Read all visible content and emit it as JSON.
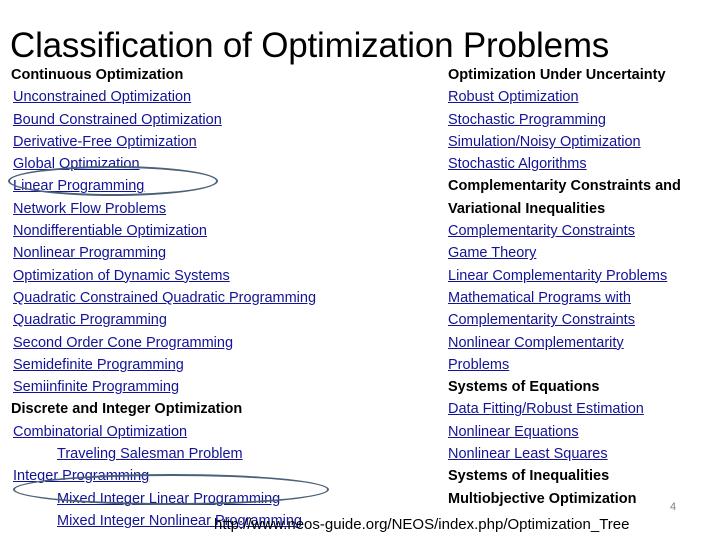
{
  "slide": {
    "title": "Classification of Optimization Problems",
    "page_number": "4",
    "footer_url": "http://www.neos-guide.org/NEOS/index.php/Optimization_Tree",
    "colors": {
      "link": "#131396",
      "text": "#000000",
      "annotation": "#4a6278",
      "page_number": "#7f7f7f",
      "background": "#ffffff"
    }
  },
  "left_column": {
    "items": [
      {
        "label": "Continuous Optimization",
        "kind": "header",
        "indent": 0
      },
      {
        "label": "Unconstrained Optimization",
        "kind": "link",
        "indent": 0
      },
      {
        "label": "Bound Constrained Optimization",
        "kind": "link",
        "indent": 0
      },
      {
        "label": "Derivative-Free Optimization",
        "kind": "link",
        "indent": 0
      },
      {
        "label": "Global Optimization",
        "kind": "link",
        "indent": 0
      },
      {
        "label": "Linear Programming",
        "kind": "link",
        "indent": 0
      },
      {
        "label": "Network Flow Problems",
        "kind": "link",
        "indent": 0
      },
      {
        "label": "Nondifferentiable Optimization",
        "kind": "link",
        "indent": 0
      },
      {
        "label": "Nonlinear Programming",
        "kind": "link",
        "indent": 0
      },
      {
        "label": "Optimization of Dynamic Systems",
        "kind": "link",
        "indent": 0
      },
      {
        "label": "Quadratic Constrained Quadratic Programming",
        "kind": "link",
        "indent": 0
      },
      {
        "label": "Quadratic Programming",
        "kind": "link",
        "indent": 0
      },
      {
        "label": "Second Order Cone Programming",
        "kind": "link",
        "indent": 0
      },
      {
        "label": "Semidefinite Programming",
        "kind": "link",
        "indent": 0
      },
      {
        "label": "Semiinfinite Programming",
        "kind": "link",
        "indent": 0
      },
      {
        "label": "Discrete and Integer Optimization",
        "kind": "header",
        "indent": 0
      },
      {
        "label": "Combinatorial Optimization",
        "kind": "link",
        "indent": 0
      },
      {
        "label": "Traveling Salesman Problem",
        "kind": "link",
        "indent": 1
      },
      {
        "label": "Integer Programming",
        "kind": "link",
        "indent": 0
      },
      {
        "label": "Mixed Integer Linear Programming",
        "kind": "link",
        "indent": 1
      },
      {
        "label": "Mixed Integer Nonlinear Programming",
        "kind": "link",
        "indent": 1
      }
    ]
  },
  "right_column": {
    "items": [
      {
        "label": "Optimization Under Uncertainty",
        "kind": "header",
        "indent": 0
      },
      {
        "label": "Robust Optimization",
        "kind": "link",
        "indent": 0
      },
      {
        "label": "Stochastic Programming",
        "kind": "link",
        "indent": 0
      },
      {
        "label": "Simulation/Noisy Optimization",
        "kind": "link",
        "indent": 0
      },
      {
        "label": "Stochastic Algorithms",
        "kind": "link",
        "indent": 0
      },
      {
        "label": "Complementarity Constraints and",
        "kind": "header",
        "indent": 0
      },
      {
        "label": "Variational Inequalities",
        "kind": "header",
        "indent": 0
      },
      {
        "label": "Complementarity Constraints",
        "kind": "link",
        "indent": 0
      },
      {
        "label": "Game Theory",
        "kind": "link",
        "indent": 0
      },
      {
        "label": "Linear Complementarity Problems",
        "kind": "link",
        "indent": 0
      },
      {
        "label": "Mathematical Programs with",
        "kind": "link",
        "indent": 0
      },
      {
        "label": "Complementarity Constraints",
        "kind": "link",
        "indent": 0
      },
      {
        "label": "Nonlinear Complementarity",
        "kind": "link",
        "indent": 0
      },
      {
        "label": "Problems",
        "kind": "link",
        "indent": 0
      },
      {
        "label": "Systems of Equations",
        "kind": "header",
        "indent": 0
      },
      {
        "label": "Data Fitting/Robust Estimation",
        "kind": "link",
        "indent": 0
      },
      {
        "label": "Nonlinear Equations",
        "kind": "link",
        "indent": 0
      },
      {
        "label": "Nonlinear Least Squares",
        "kind": "link",
        "indent": 0
      },
      {
        "label": "Systems of Inequalities",
        "kind": "header",
        "indent": 0
      },
      {
        "label": "Multiobjective Optimization",
        "kind": "header",
        "indent": 0
      }
    ]
  },
  "annotations": [
    {
      "name": "ellipse-linear-programming",
      "targets": "Linear Programming"
    },
    {
      "name": "ellipse-milp",
      "targets": "Mixed Integer Linear Programming"
    }
  ]
}
